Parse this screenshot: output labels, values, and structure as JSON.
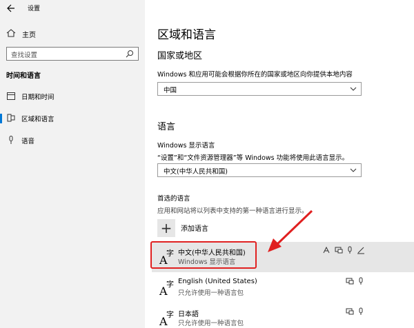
{
  "window": {
    "title": "设置"
  },
  "sidebar": {
    "home_label": "主页",
    "search_placeholder": "查找设置",
    "section_title": "时间和语言",
    "items": [
      {
        "label": "日期和时间",
        "icon": "calendar-icon"
      },
      {
        "label": "区域和语言",
        "icon": "region-icon",
        "selected": true
      },
      {
        "label": "语音",
        "icon": "microphone-icon"
      }
    ]
  },
  "main": {
    "title": "区域和语言",
    "country": {
      "heading": "国家或地区",
      "description": "Windows 和应用可能会根据你所在的国家或地区向你提供本地内容",
      "value": "中国"
    },
    "language": {
      "heading": "语言",
      "display_label": "Windows 显示语言",
      "display_desc": "“设置”和“文件资源管理器”等 Windows 功能将使用此语言显示。",
      "display_value": "中文(中华人民共和国)",
      "preferred_label": "首选的语言",
      "preferred_desc": "应用和网站将以列表中支持的第一种语言进行显示。",
      "add_label": "添加语言",
      "list": [
        {
          "name": "中文(中华人民共和国)",
          "sub": "Windows 显示语言",
          "selected": true
        },
        {
          "name": "English (United States)",
          "sub": "只允许使用一种语言包"
        },
        {
          "name": "日本語",
          "sub": "只允许使用一种语言包"
        }
      ]
    }
  },
  "colors": {
    "accent": "#0078d7",
    "annotation": "#e02020",
    "sidebar_bg": "#f2f2f2",
    "selected_row": "#e6e6e6"
  }
}
